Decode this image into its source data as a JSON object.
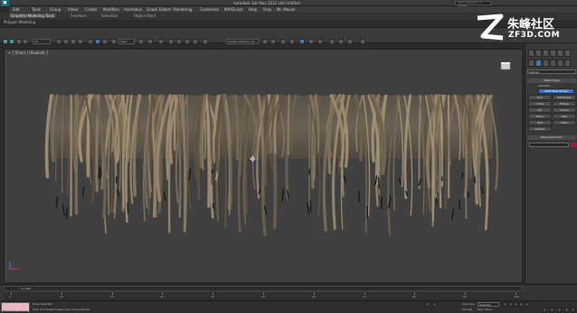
{
  "app": {
    "title": "Autodesk 3ds Max 2012 x64    Untitled",
    "search_placeholder": "Type a keyword or phrase",
    "logo": "3ds-max-logo-icon"
  },
  "menu": [
    "Edit",
    "Tools",
    "Group",
    "Views",
    "Create",
    "Modifiers",
    "Animation",
    "Graph Editors",
    "Rendering",
    "Customize",
    "MAXScript",
    "Help",
    "Vray",
    "Mr. Mouse"
  ],
  "ribbon": {
    "tabs": [
      "Graphite Modeling Tools",
      "Freeform",
      "Selection",
      "Object Paint"
    ],
    "sub_label": "Polygon Modeling"
  },
  "toolbar": {
    "selection_filter": "All",
    "ref_coord": "View",
    "named_selection": "Create Selection Se"
  },
  "watermark": {
    "brand": "朱峰社区",
    "url": "ZF3D.COM"
  },
  "viewport": {
    "label": "+ ] [Front ] [Realistic ]"
  },
  "command_panel": {
    "category": "Splines",
    "object_type_title": "Object Type",
    "autogrid": "AutoGrid",
    "start_new_shape": "Start New Shape",
    "buttons": [
      "Line",
      "Rectangle",
      "Circle",
      "Ellipse",
      "Arc",
      "Donut",
      "NGon",
      "Star",
      "Text",
      "Helix",
      "Section"
    ],
    "name_color_title": "Name and Color",
    "object_color": "#b3103c"
  },
  "timeline": {
    "frame_readout": "0 / 100",
    "ticks": [
      "0",
      "10",
      "20",
      "30",
      "40",
      "50",
      "60",
      "70",
      "80",
      "90",
      "100"
    ]
  },
  "status": {
    "maxscript_label": "Maxscript Listener",
    "selection": "None Selected",
    "prompt": "Click and drag to select and move objects",
    "auto_key": "Auto Key",
    "selected_dropdown": "Selected",
    "set_key": "Set Key",
    "key_filters": "Key Filters..."
  }
}
